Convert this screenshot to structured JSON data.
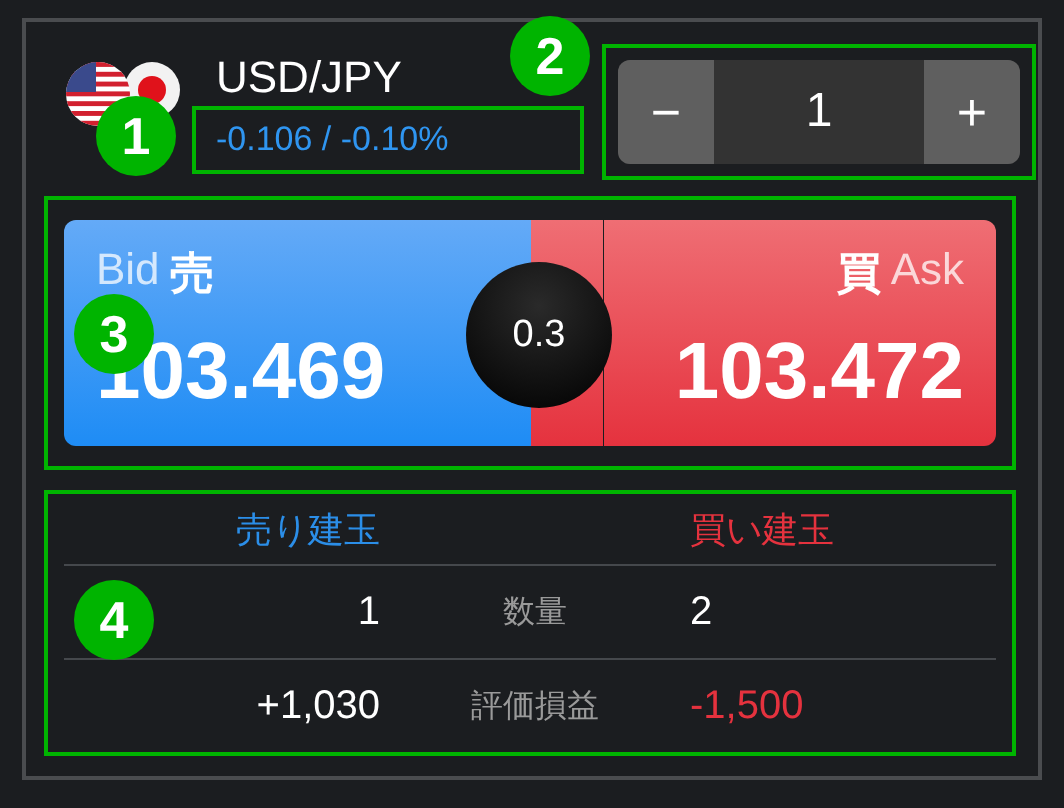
{
  "annotations": [
    {
      "label": "1"
    },
    {
      "label": "2"
    },
    {
      "label": "3"
    },
    {
      "label": "4"
    }
  ],
  "pair": {
    "title": "USD/JPY",
    "change": "-0.106 / -0.10%"
  },
  "stepper": {
    "minus": "−",
    "value": "1",
    "plus": "+"
  },
  "quote": {
    "bid": {
      "label_en": "Bid",
      "label_ja": "売",
      "price": "103.469"
    },
    "spread": "0.3",
    "ask": {
      "label_ja": "買",
      "label_en": "Ask",
      "price": "103.472"
    }
  },
  "positions": {
    "sell_header": "売り建玉",
    "buy_header": "買い建玉",
    "rows": [
      {
        "label": "数量",
        "sell": {
          "text": "1",
          "loss": false
        },
        "buy": {
          "text": "2",
          "loss": false
        }
      },
      {
        "label": "評価損益",
        "sell": {
          "text": "+1,030",
          "loss": false
        },
        "buy": {
          "text": "-1,500",
          "loss": true
        }
      }
    ]
  }
}
